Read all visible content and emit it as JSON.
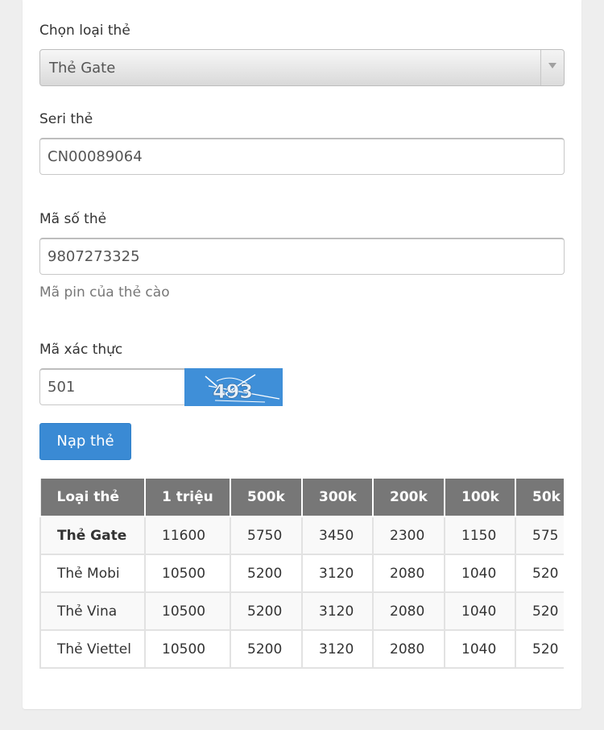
{
  "form": {
    "card_type_label": "Chọn loại thẻ",
    "card_type_value": "Thẻ Gate",
    "serial_label": "Seri thẻ",
    "serial_value": "CN00089064",
    "pin_label": "Mã số thẻ",
    "pin_value": "9807273325",
    "pin_help": "Mã pin của thẻ cào",
    "captcha_label": "Mã xác thực",
    "captcha_value": "501",
    "captcha_image_text": "493",
    "submit_label": "Nạp thẻ"
  },
  "rates_table": {
    "headers": [
      "Loại thẻ",
      "1 triệu",
      "500k",
      "300k",
      "200k",
      "100k",
      "50k"
    ],
    "rows": [
      [
        "Thẻ Gate",
        "11600",
        "5750",
        "3450",
        "2300",
        "1150",
        "575"
      ],
      [
        "Thẻ Mobi",
        "10500",
        "5200",
        "3120",
        "2080",
        "1040",
        "520"
      ],
      [
        "Thẻ Vina",
        "10500",
        "5200",
        "3120",
        "2080",
        "1040",
        "520"
      ],
      [
        "Thẻ Viettel",
        "10500",
        "5200",
        "3120",
        "2080",
        "1040",
        "520"
      ]
    ]
  },
  "colors": {
    "primary_button": "#3a8ad4",
    "table_header": "#777777"
  }
}
